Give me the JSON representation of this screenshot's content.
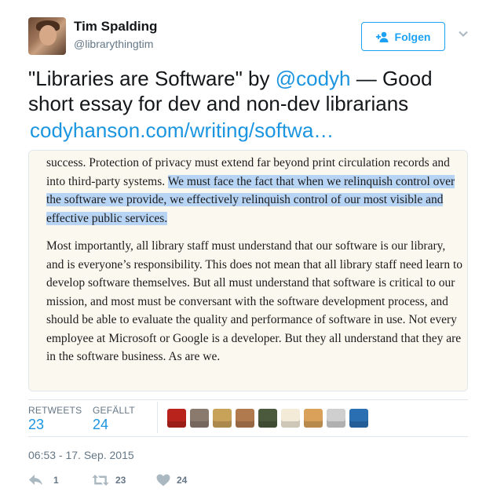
{
  "author": {
    "name": "Tim Spalding",
    "handle": "@librarythingtim",
    "avatar_icon": "user-photo"
  },
  "follow_button": {
    "label": "Folgen",
    "icon": "add-user-icon",
    "color": "#1da1f2"
  },
  "menu_caret_icon": "chevron-down-icon",
  "tweet": {
    "text_before": "\"Libraries are Software\" by ",
    "mention": "@codyh",
    "text_after": " — Good short essay for dev and non-dev librarians",
    "link": "codyhanson.com/writing/softwa…"
  },
  "media": {
    "paragraph1_plain": "success. Protection of privacy must extend far beyond print circulation records and into third-party systems. ",
    "paragraph1_highlight": "We must face the fact that when we relinquish control over the software we provide, we effectively relinquish control of our most visible and effective public services.",
    "paragraph2": "Most importantly, all library staff must understand that our software is our library, and is everyone’s responsibility. This does not mean that all library staff need learn to develop software themselves. But all must understand that software is critical to our mission, and most must be conversant with the software development process, and should be able to evaluate the quality and performance of software in use. Not every employee at Microsoft or Google is a developer. But they all understand that they are in the software business. As are we.",
    "highlight_color": "#b7d4f5",
    "background": "#fbf8ef"
  },
  "stats": {
    "retweets_label": "RETWEETS",
    "retweets_value": "23",
    "likes_label": "GEFÄLLT",
    "likes_value": "24"
  },
  "liker_avatars": [
    "#b8231c",
    "#8a7a6e",
    "#c9a25a",
    "#b07a4e",
    "#4b5a3c",
    "#f3ead7",
    "#d9a15a",
    "#cfcfcf",
    "#2b6fb3"
  ],
  "timestamp": "06:53 - 17. Sep. 2015",
  "actions": {
    "reply_count": "1",
    "retweet_count": "23",
    "like_count": "24"
  },
  "colors": {
    "link": "#1b95e0",
    "muted": "#657786",
    "divider": "#e1e8ed"
  }
}
